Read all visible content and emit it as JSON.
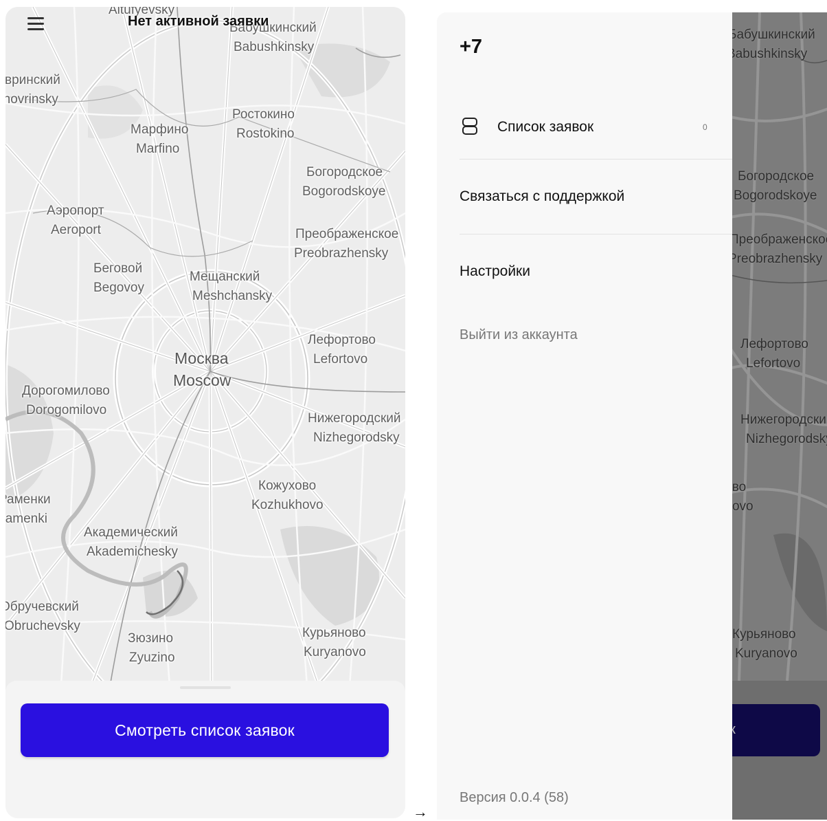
{
  "left_screen": {
    "title": "Нет активной заявки",
    "menu_icon": "hamburger-menu-icon",
    "primary_button": "Смотреть список заявок",
    "map_labels": [
      "Altufyevsky",
      "Бабушкинский",
      "Babushkinsky",
      "Ховринский",
      "Khovrinsky",
      "Ростокино",
      "Rostokino",
      "Марфино",
      "Marfino",
      "Богородское",
      "Bogorodskoye",
      "Аэропорт",
      "Aeroport",
      "Преображенское",
      "Preobrazhensky",
      "Беговой",
      "Begovoy",
      "Мещанский",
      "Meshchansky",
      "Лефортово",
      "Lefortovo",
      "Москва",
      "Moscow",
      "Дорогомилово",
      "Dorogomilovo",
      "Нижегородский",
      "Nizhegorodsky",
      "Кожухово",
      "Kozhukhovo",
      "Раменки",
      "Ramenki",
      "Академический",
      "Akademichesky",
      "Обручевский",
      "Obruchevsky",
      "Зюзино",
      "Zyuzino",
      "Курьяново",
      "Kuryanovo"
    ]
  },
  "arrow": "→",
  "right_screen": {
    "phone": "+7",
    "menu": {
      "orders_label": "Список заявок",
      "orders_count": "0",
      "support_label": "Связаться с поддержкой",
      "settings_label": "Настройки",
      "logout_label": "Выйти из аккаунта"
    },
    "version": "Версия 0.0.4 (58)",
    "map_labels": [
      "Бабушкинский",
      "Babushkinsky",
      "Богородское",
      "Bogorodskoye",
      "Преображенское",
      "Preobrazhensky",
      "Лефортово",
      "Lefortovo",
      "Нижегородский",
      "Nizhegorodsky",
      "Кожухово",
      "Kozhukhovo",
      "Курьяново",
      "Kuryanovo"
    ],
    "button_fragment": "к"
  },
  "colors": {
    "primary": "#2a10e0",
    "drawer_bg": "#f8f8f8",
    "overlay_map": "#7d7d7d"
  }
}
